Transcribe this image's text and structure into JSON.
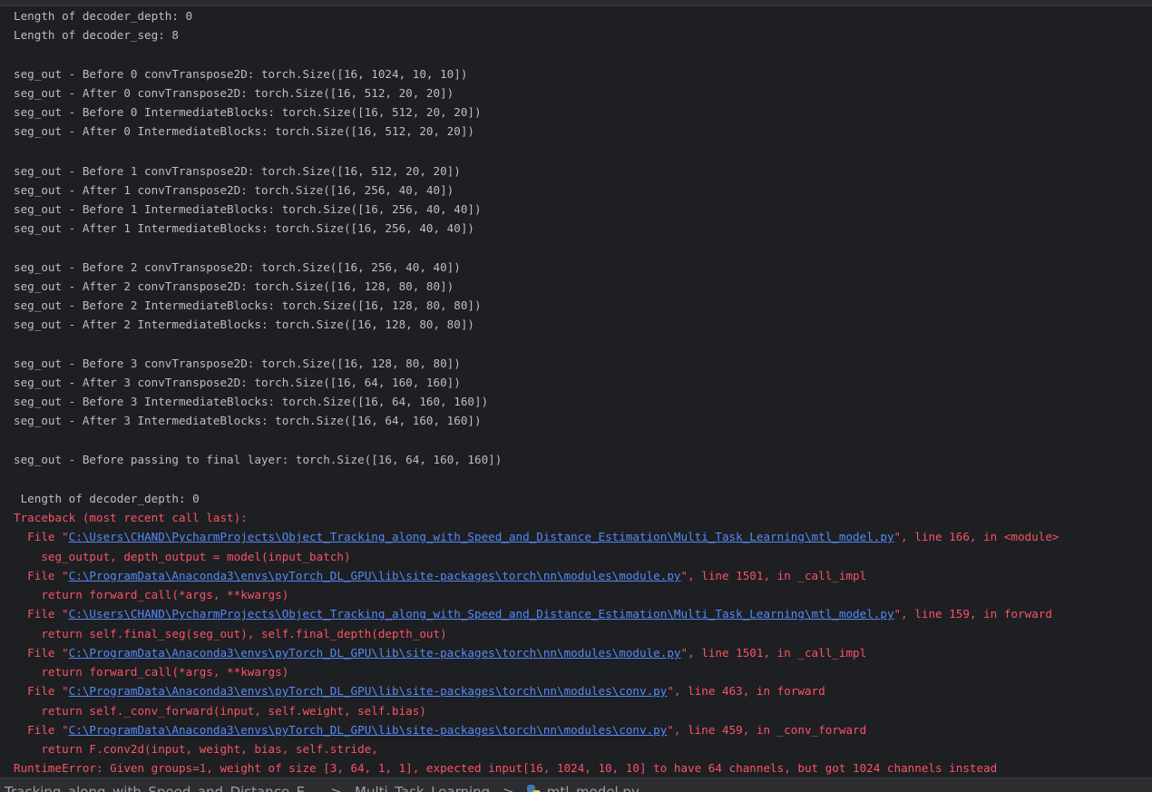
{
  "console": {
    "plain_lines": [
      "Length of decoder_depth: 0",
      "Length of decoder_seg: 8",
      "seg_out - Before 0 convTranspose2D: torch.Size([16, 1024, 10, 10])",
      "seg_out - After 0 convTranspose2D: torch.Size([16, 512, 20, 20])",
      "seg_out - Before 0 IntermediateBlocks: torch.Size([16, 512, 20, 20])",
      "seg_out - After 0 IntermediateBlocks: torch.Size([16, 512, 20, 20])",
      "seg_out - Before 1 convTranspose2D: torch.Size([16, 512, 20, 20])",
      "seg_out - After 1 convTranspose2D: torch.Size([16, 256, 40, 40])",
      "seg_out - Before 1 IntermediateBlocks: torch.Size([16, 256, 40, 40])",
      "seg_out - After 1 IntermediateBlocks: torch.Size([16, 256, 40, 40])",
      "seg_out - Before 2 convTranspose2D: torch.Size([16, 256, 40, 40])",
      "seg_out - After 2 convTranspose2D: torch.Size([16, 128, 80, 80])",
      "seg_out - Before 2 IntermediateBlocks: torch.Size([16, 128, 80, 80])",
      "seg_out - After 2 IntermediateBlocks: torch.Size([16, 128, 80, 80])",
      "seg_out - Before 3 convTranspose2D: torch.Size([16, 128, 80, 80])",
      "seg_out - After 3 convTranspose2D: torch.Size([16, 64, 160, 160])",
      "seg_out - Before 3 IntermediateBlocks: torch.Size([16, 64, 160, 160])",
      "seg_out - After 3 IntermediateBlocks: torch.Size([16, 64, 160, 160])",
      "seg_out - Before passing to final layer: torch.Size([16, 64, 160, 160])",
      " Length of decoder_depth: 0"
    ],
    "traceback_header": "Traceback (most recent call last):",
    "frames": [
      {
        "prefix": "  File \"",
        "path": "C:\\Users\\CHAND\\PycharmProjects\\Object_Tracking_along_with_Speed_and_Distance_Estimation\\Multi_Task_Learning\\mtl_model.py",
        "suffix": "\", line 166, in <module>",
        "code": "    seg_output, depth_output = model(input_batch)"
      },
      {
        "prefix": "  File \"",
        "path": "C:\\ProgramData\\Anaconda3\\envs\\pyTorch_DL_GPU\\lib\\site-packages\\torch\\nn\\modules\\module.py",
        "suffix": "\", line 1501, in _call_impl",
        "code": "    return forward_call(*args, **kwargs)"
      },
      {
        "prefix": "  File \"",
        "path": "C:\\Users\\CHAND\\PycharmProjects\\Object_Tracking_along_with_Speed_and_Distance_Estimation\\Multi_Task_Learning\\mtl_model.py",
        "suffix": "\", line 159, in forward",
        "code": "    return self.final_seg(seg_out), self.final_depth(depth_out)"
      },
      {
        "prefix": "  File \"",
        "path": "C:\\ProgramData\\Anaconda3\\envs\\pyTorch_DL_GPU\\lib\\site-packages\\torch\\nn\\modules\\module.py",
        "suffix": "\", line 1501, in _call_impl",
        "code": "    return forward_call(*args, **kwargs)"
      },
      {
        "prefix": "  File \"",
        "path": "C:\\ProgramData\\Anaconda3\\envs\\pyTorch_DL_GPU\\lib\\site-packages\\torch\\nn\\modules\\conv.py",
        "suffix": "\", line 463, in forward",
        "code": "    return self._conv_forward(input, self.weight, self.bias)"
      },
      {
        "prefix": "  File \"",
        "path": "C:\\ProgramData\\Anaconda3\\envs\\pyTorch_DL_GPU\\lib\\site-packages\\torch\\nn\\modules\\conv.py",
        "suffix": "\", line 459, in _conv_forward",
        "code": "    return F.conv2d(input, weight, bias, self.stride,"
      }
    ],
    "error_message": "RuntimeError: Given groups=1, weight of size [3, 64, 1, 1], expected input[16, 1024, 10, 10] to have 64 channels, but got 1024 channels instead"
  },
  "statusbar": {
    "project": "Tracking_along_with_Speed_and_Distance_E...",
    "separator": ">",
    "folder": "Multi_Task_Learning",
    "file": "mtl_model.py",
    "file_icon": "python-file-icon"
  },
  "colors": {
    "background": "#1e1f22",
    "text": "#bcbec4",
    "error": "#f75464",
    "link": "#548af7"
  }
}
